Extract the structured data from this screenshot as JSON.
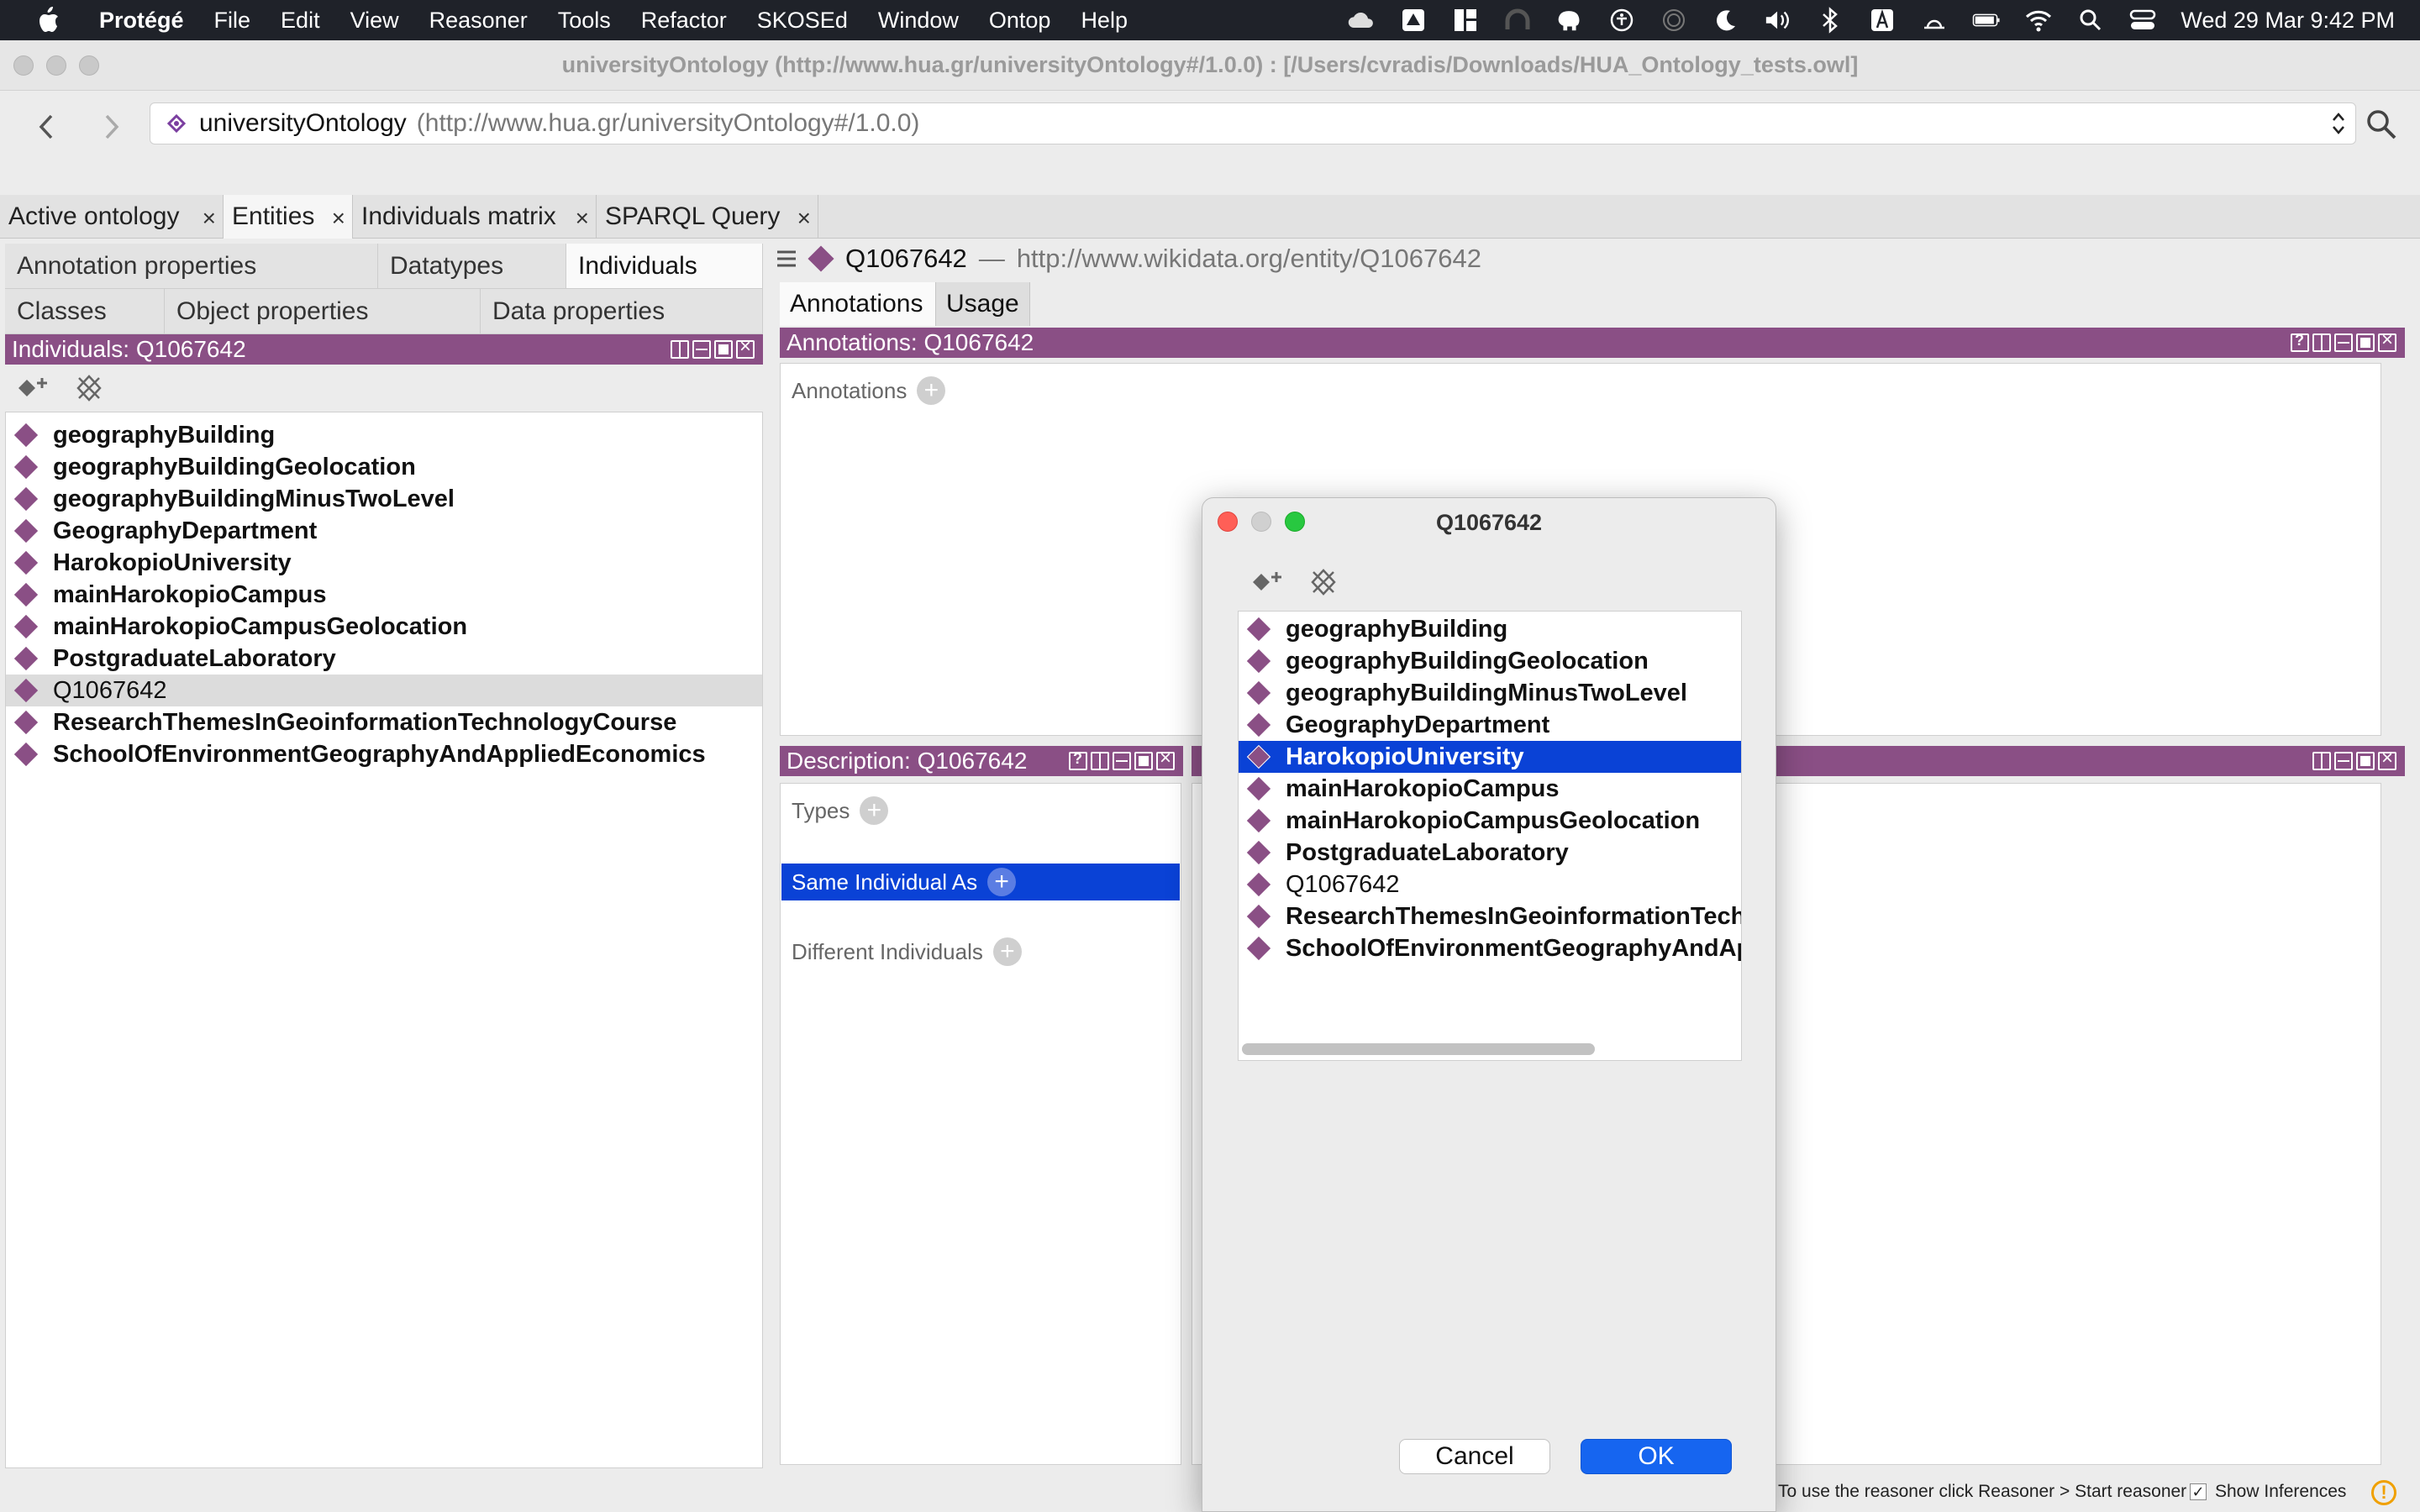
{
  "menubar": {
    "app_name": "Protégé",
    "items": [
      "File",
      "Edit",
      "View",
      "Reasoner",
      "Tools",
      "Refactor",
      "SKOSEd",
      "Window",
      "Ontop",
      "Help"
    ],
    "clock": "Wed 29 Mar  9:42 PM"
  },
  "window": {
    "title": "universityOntology (http://www.hua.gr/universityOntology#/1.0.0)  : [/Users/cvradis/Downloads/HUA_Ontology_tests.owl]"
  },
  "address": {
    "ontology_name": "universityOntology",
    "ontology_iri": "(http://www.hua.gr/universityOntology#/1.0.0)"
  },
  "tabs": [
    {
      "label": "Active ontology",
      "close": "×"
    },
    {
      "label": "Entities",
      "close": "×"
    },
    {
      "label": "Individuals matrix",
      "close": "×"
    },
    {
      "label": "SPARQL Query",
      "close": "×"
    }
  ],
  "entity_tabs": {
    "row1": [
      "Annotation properties",
      "Datatypes",
      "Individuals"
    ],
    "row2": [
      "Classes",
      "Object properties",
      "Data properties"
    ]
  },
  "individuals_view": {
    "title": "Individuals: Q1067642",
    "items": [
      "geographyBuilding",
      "geographyBuildingGeolocation",
      "geographyBuildingMinusTwoLevel",
      "GeographyDepartment",
      "HarokopioUniversity",
      "mainHarokopioCampus",
      "mainHarokopioCampusGeolocation",
      "PostgraduateLaboratory",
      "Q1067642",
      "ResearchThemesInGeoinformationTechnologyCourse",
      "SchoolOfEnvironmentGeographyAndAppliedEconomics"
    ]
  },
  "entity": {
    "name": "Q1067642",
    "separator": "—",
    "iri": "http://www.wikidata.org/entity/Q1067642"
  },
  "right_tabs": [
    "Annotations",
    "Usage"
  ],
  "annotations_view": {
    "title": "Annotations: Q1067642",
    "label": "Annotations"
  },
  "description_view": {
    "title": "Description: Q1067642",
    "types_label": "Types",
    "same_label": "Same Individual As",
    "different_label": "Different Individuals"
  },
  "status": {
    "reasoner_message": "To use the reasoner click Reasoner > Start reasoner",
    "show_inferences": "Show Inferences",
    "checkmark": "✓",
    "warning": "!"
  },
  "dialog": {
    "title": "Q1067642",
    "items": [
      "geographyBuilding",
      "geographyBuildingGeolocation",
      "geographyBuildingMinusTwoLevel",
      "GeographyDepartment",
      "HarokopioUniversity",
      "mainHarokopioCampus",
      "mainHarokopioCampusGeolocation",
      "PostgraduateLaboratory",
      "Q1067642",
      "ResearchThemesInGeoinformationTechnologyCourse",
      "SchoolOfEnvironmentGeographyAndAppliedEconomics"
    ],
    "cancel_label": "Cancel",
    "ok_label": "OK"
  },
  "colors": {
    "view_bar": "#8a4f85",
    "selection_blue": "#0a42d6",
    "ok_button": "#1665f0"
  },
  "icons": {
    "add_individual": "add-individual-icon",
    "delete_individual": "delete-individual-icon",
    "individual": "individual-diamond-icon"
  }
}
